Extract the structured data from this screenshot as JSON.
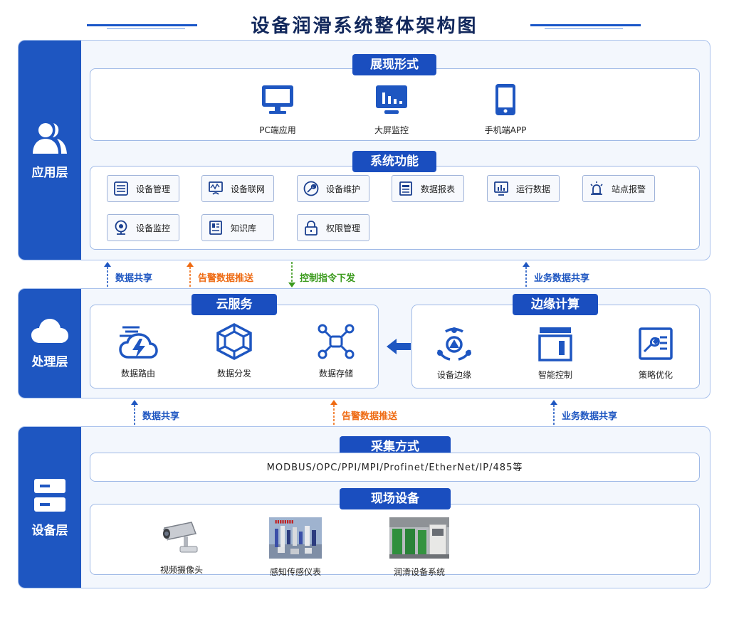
{
  "title": "设备润滑系统整体架构图",
  "colors": {
    "primary": "#1e56c1",
    "orange": "#ee6a12",
    "green": "#3a9a1c",
    "navy": "#12285c"
  },
  "app_layer": {
    "label": "应用层",
    "icon": "users-icon",
    "display": {
      "title": "展现形式",
      "items": [
        {
          "label": "PC端应用",
          "icon": "monitor-icon"
        },
        {
          "label": "大屏监控",
          "icon": "dashboard-screen-icon"
        },
        {
          "label": "手机端APP",
          "icon": "phone-icon"
        }
      ]
    },
    "functions": {
      "title": "系统功能",
      "items": [
        {
          "label": "设备管理",
          "icon": "list-icon"
        },
        {
          "label": "设备联网",
          "icon": "network-icon"
        },
        {
          "label": "设备维护",
          "icon": "wrench-icon"
        },
        {
          "label": "数据报表",
          "icon": "report-icon"
        },
        {
          "label": "运行数据",
          "icon": "chart-monitor-icon"
        },
        {
          "label": "站点报警",
          "icon": "alarm-icon"
        },
        {
          "label": "设备监控",
          "icon": "camera-icon"
        },
        {
          "label": "知识库",
          "icon": "book-icon"
        },
        {
          "label": "权限管理",
          "icon": "lock-icon"
        }
      ]
    }
  },
  "arrows_top": [
    {
      "label": "数据共享",
      "color": "#1e56c1",
      "direction": "up"
    },
    {
      "label": "告警数据推送",
      "color": "#ee6a12",
      "direction": "up"
    },
    {
      "label": "控制指令下发",
      "color": "#3a9a1c",
      "direction": "down"
    },
    {
      "label": "业务数据共享",
      "color": "#1e56c1",
      "direction": "up"
    }
  ],
  "proc_layer": {
    "label": "处理层",
    "icon": "cloud-icon",
    "cloud": {
      "title": "云服务",
      "items": [
        {
          "label": "数据路由",
          "icon": "cloud-lightning-icon"
        },
        {
          "label": "数据分发",
          "icon": "hexagon-network-icon"
        },
        {
          "label": "数据存储",
          "icon": "nodes-icon"
        }
      ]
    },
    "edge": {
      "title": "边缘计算",
      "items": [
        {
          "label": "设备边缘",
          "icon": "edge-device-icon"
        },
        {
          "label": "智能控制",
          "icon": "control-box-icon"
        },
        {
          "label": "策略优化",
          "icon": "strategy-icon"
        }
      ]
    }
  },
  "arrows_bottom": [
    {
      "label": "数据共享",
      "color": "#1e56c1",
      "direction": "up"
    },
    {
      "label": "告警数据推送",
      "color": "#ee6a12",
      "direction": "up"
    },
    {
      "label": "业务数据共享",
      "color": "#1e56c1",
      "direction": "up"
    }
  ],
  "device_layer": {
    "label": "设备层",
    "icon": "server-icon",
    "collection": {
      "title": "采集方式",
      "protocols": "MODBUS/OPC/PPI/MPI/Profinet/EtherNet/IP/485等"
    },
    "field": {
      "title": "现场设备",
      "items": [
        {
          "label": "视频摄像头",
          "icon": "cctv-camera-icon"
        },
        {
          "label": "感知传感仪表",
          "icon": "sensor-photo-icon"
        },
        {
          "label": "润滑设备系统",
          "icon": "lubrication-photo-icon"
        }
      ]
    }
  }
}
